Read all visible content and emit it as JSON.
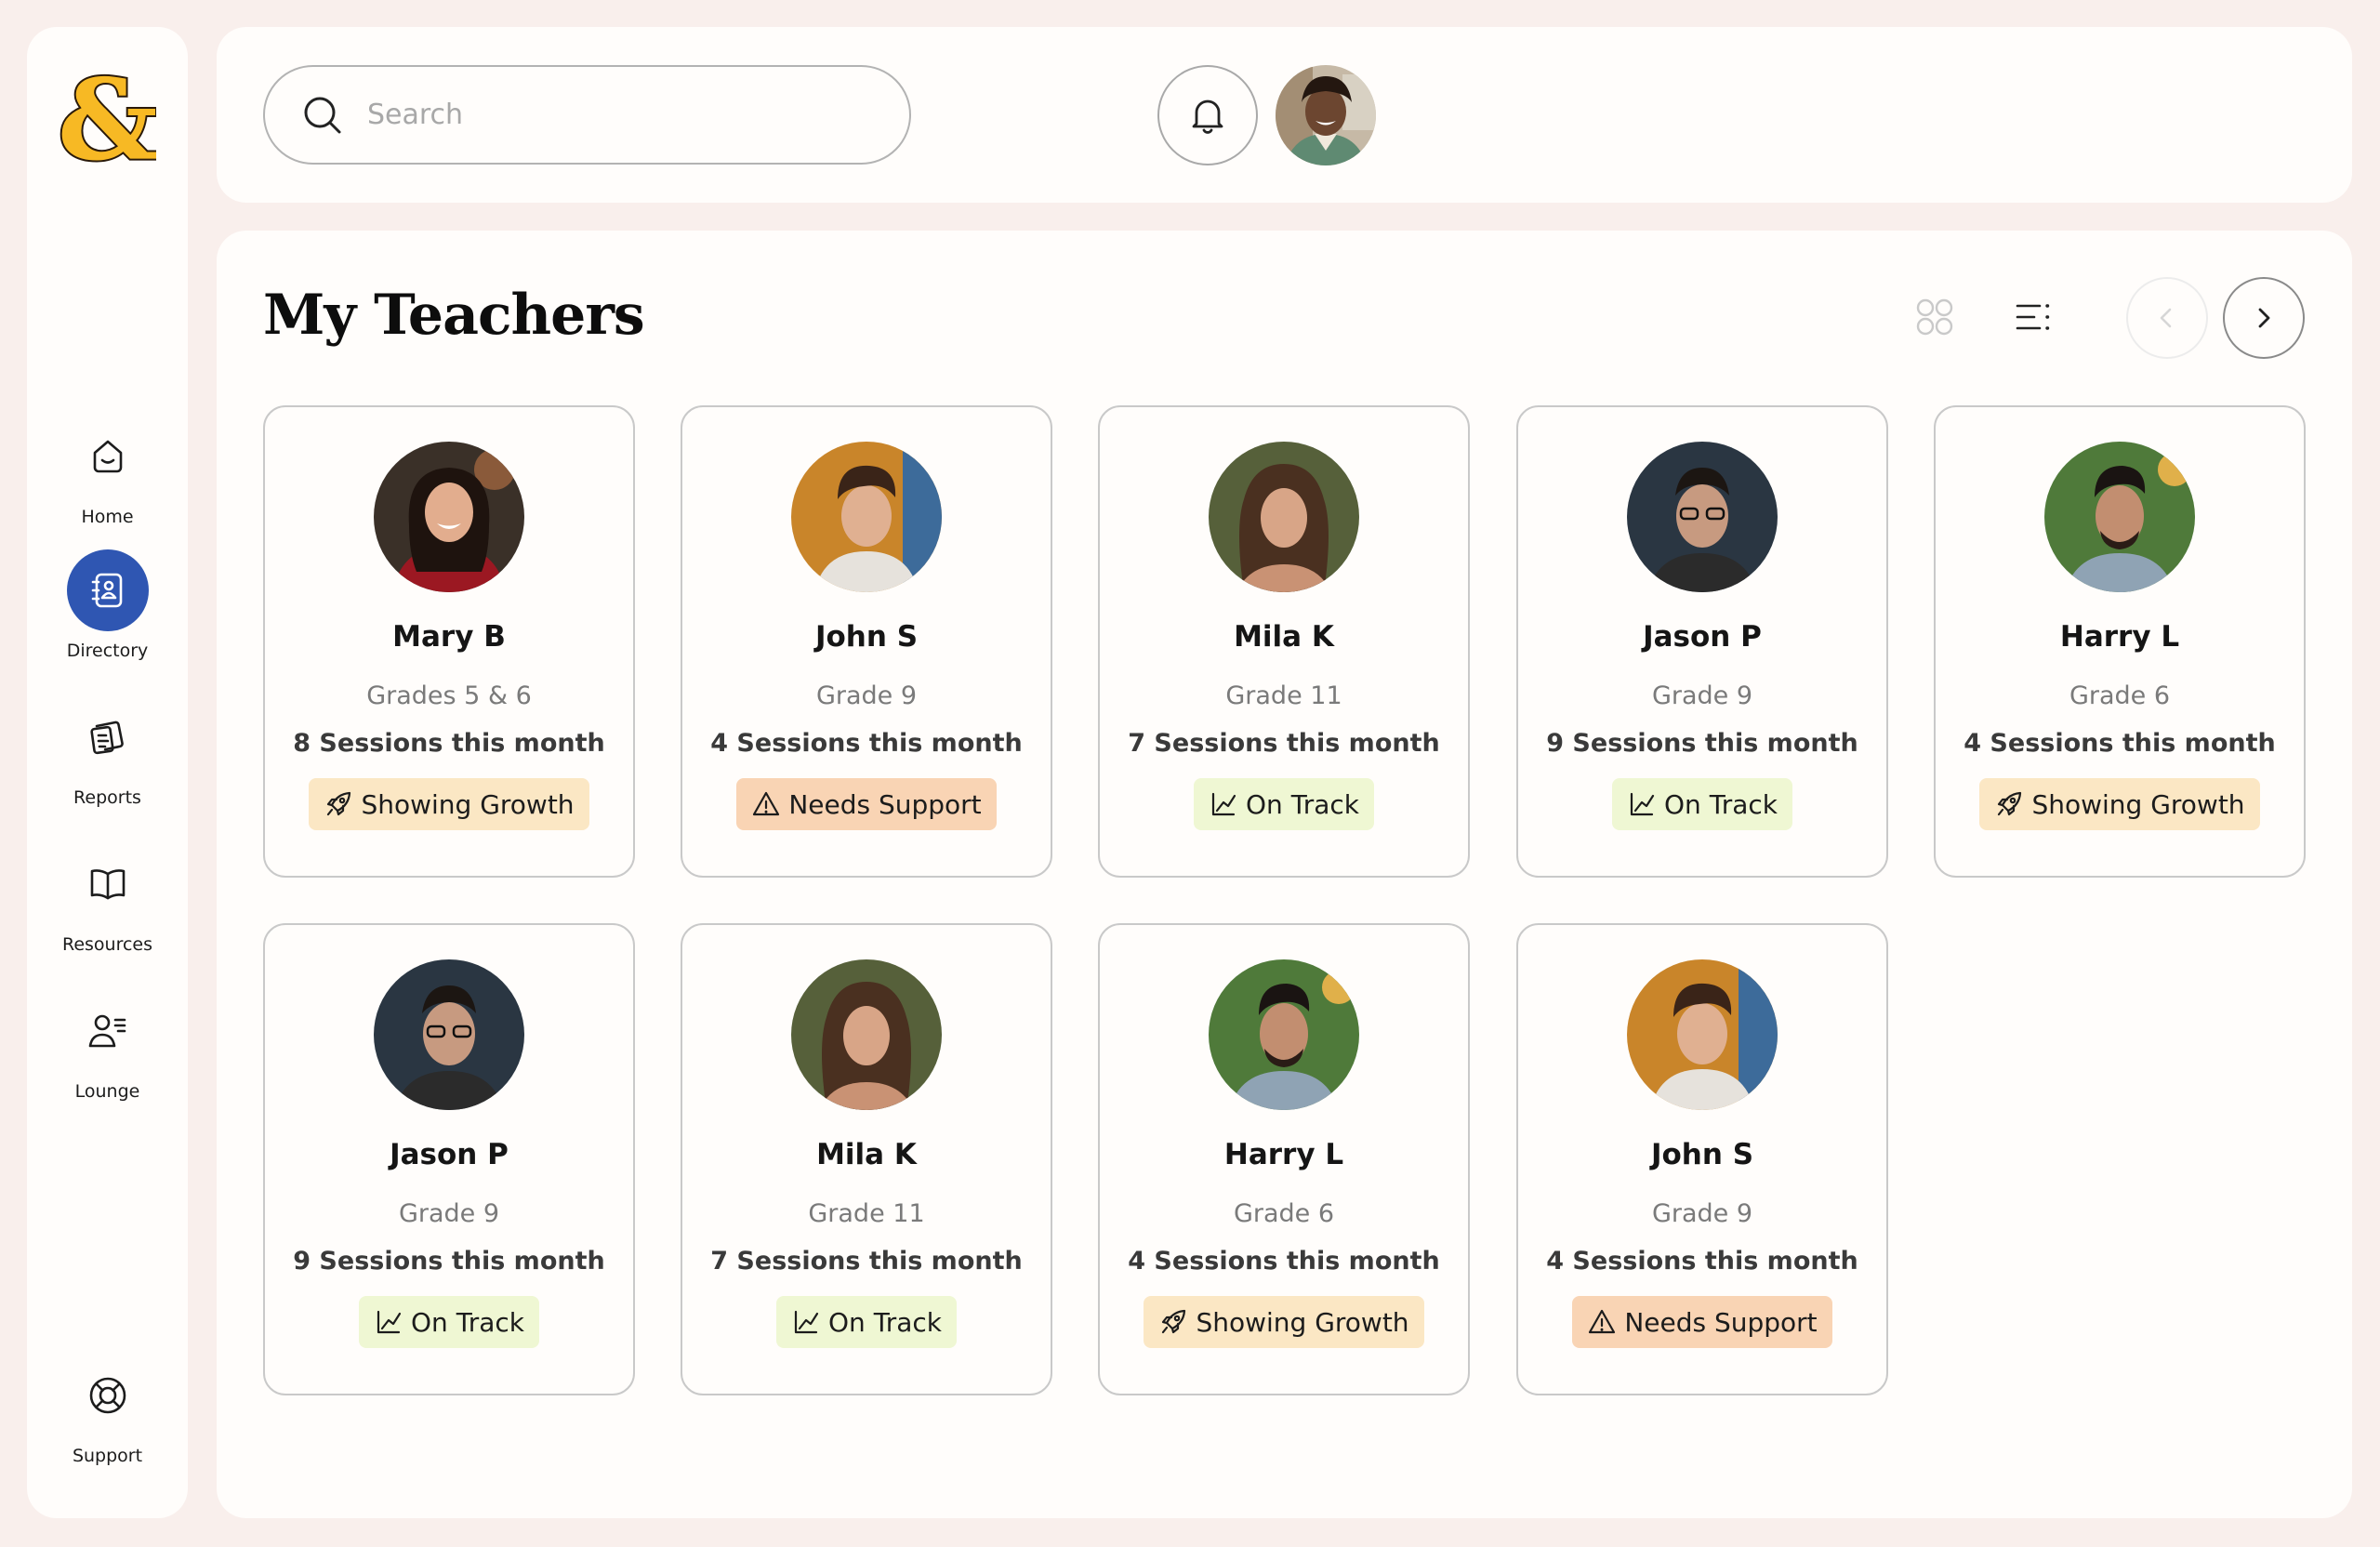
{
  "sidebar": {
    "logo_icon": "ampersand-logo",
    "items": [
      {
        "label": "Home",
        "icon": "home-icon",
        "active": false
      },
      {
        "label": "Directory",
        "icon": "contact-book-icon",
        "active": true
      },
      {
        "label": "Reports",
        "icon": "reports-icon",
        "active": false
      },
      {
        "label": "Resources",
        "icon": "book-icon",
        "active": false
      },
      {
        "label": "Lounge",
        "icon": "users-icon",
        "active": false
      },
      {
        "label": "Support",
        "icon": "lifebuoy-icon",
        "active": false
      }
    ]
  },
  "header": {
    "search": {
      "placeholder": "Search",
      "value": ""
    },
    "notifications_icon": "bell-icon",
    "user_avatar_icon": "user-avatar"
  },
  "main": {
    "title": "My Teachers",
    "view_options": [
      "grid-view-icon",
      "list-view-icon"
    ],
    "pagination": {
      "prev_icon": "chevron-left-icon",
      "next_icon": "chevron-right-icon",
      "prev_enabled": false
    }
  },
  "teachers": [
    {
      "name": "Mary B",
      "grade": "Grades 5 & 6",
      "sessions": "8 Sessions this month",
      "status": "Showing Growth",
      "status_type": "growth"
    },
    {
      "name": "John S",
      "grade": "Grade 9",
      "sessions": "4 Sessions this month",
      "status": "Needs Support",
      "status_type": "support"
    },
    {
      "name": "Mila K",
      "grade": "Grade 11",
      "sessions": "7 Sessions this month",
      "status": "On Track",
      "status_type": "track"
    },
    {
      "name": "Jason P",
      "grade": "Grade 9",
      "sessions": "9 Sessions this month",
      "status": "On Track",
      "status_type": "track"
    },
    {
      "name": "Harry L",
      "grade": "Grade 6",
      "sessions": "4 Sessions this month",
      "status": "Showing Growth",
      "status_type": "growth"
    },
    {
      "name": "Jason P",
      "grade": "Grade 9",
      "sessions": "9 Sessions this month",
      "status": "On Track",
      "status_type": "track"
    },
    {
      "name": "Mila K",
      "grade": "Grade 11",
      "sessions": "7 Sessions this month",
      "status": "On Track",
      "status_type": "track"
    },
    {
      "name": "Harry L",
      "grade": "Grade 6",
      "sessions": "4 Sessions this month",
      "status": "Showing Growth",
      "status_type": "growth"
    },
    {
      "name": "John S",
      "grade": "Grade 9",
      "sessions": "4 Sessions this month",
      "status": "Needs Support",
      "status_type": "support"
    }
  ],
  "colors": {
    "background": "#f9efec",
    "panel": "#fffdfb",
    "accent_blue": "#2f56b2",
    "logo_yellow": "#f7b924",
    "growth_badge": "#fbe7c4",
    "support_badge": "#f9d4b4",
    "track_badge": "#eff7d3"
  }
}
